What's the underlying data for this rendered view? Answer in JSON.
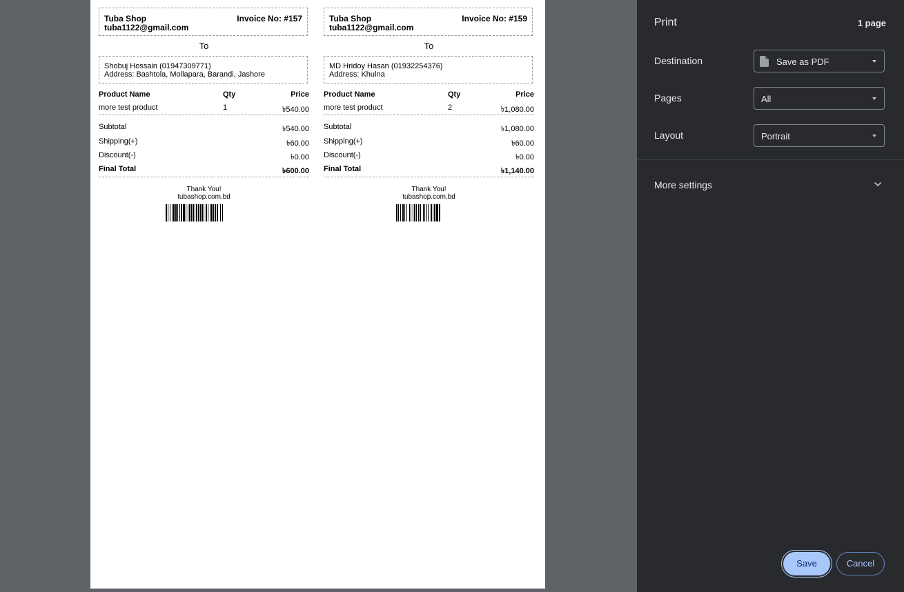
{
  "invoices": [
    {
      "shop_name": "Tuba Shop",
      "shop_email": "tuba1122@gmail.com",
      "invoice_no": "Invoice No: #157",
      "to_label": "To",
      "customer": "Shobuj Hossain (01947309771)",
      "address": "Address: Bashtola, Mollapara, Barandi, Jashore",
      "headers": {
        "name": "Product Name",
        "qty": "Qty",
        "price": "Price"
      },
      "item": {
        "name": "more test product",
        "qty": "1",
        "price": "৳540.00"
      },
      "subtotal_label": "Subtotal",
      "subtotal": "৳540.00",
      "shipping_label": "Shipping(+)",
      "shipping": "৳60.00",
      "discount_label": "Discount(-)",
      "discount": "৳0.00",
      "total_label": "Final Total",
      "total": "৳600.00",
      "thanks": "Thank You!",
      "site": "tubashop.com.bd"
    },
    {
      "shop_name": "Tuba Shop",
      "shop_email": "tuba1122@gmail.com",
      "invoice_no": "Invoice No: #159",
      "to_label": "To",
      "customer": "MD Hridoy Hasan (01932254376)",
      "address": "Address: Khulna",
      "headers": {
        "name": "Product Name",
        "qty": "Qty",
        "price": "Price"
      },
      "item": {
        "name": "more test product",
        "qty": "2",
        "price": "৳1,080.00"
      },
      "subtotal_label": "Subtotal",
      "subtotal": "৳1,080.00",
      "shipping_label": "Shipping(+)",
      "shipping": "৳60.00",
      "discount_label": "Discount(-)",
      "discount": "৳0.00",
      "total_label": "Final Total",
      "total": "৳1,140.00",
      "thanks": "Thank You!",
      "site": "tubashop.com.bd"
    }
  ],
  "print_panel": {
    "title": "Print",
    "page_count": "1 page",
    "destination_label": "Destination",
    "destination_value": "Save as PDF",
    "pages_label": "Pages",
    "pages_value": "All",
    "layout_label": "Layout",
    "layout_value": "Portrait",
    "more_settings": "More settings",
    "save_label": "Save",
    "cancel_label": "Cancel"
  },
  "colors": {
    "panel_bg": "#292a2d",
    "preview_bg": "#5f6368",
    "accent": "#a8c7fa"
  },
  "icons": [
    "document-icon",
    "dropdown-arrow-icon",
    "chevron-down-icon"
  ]
}
